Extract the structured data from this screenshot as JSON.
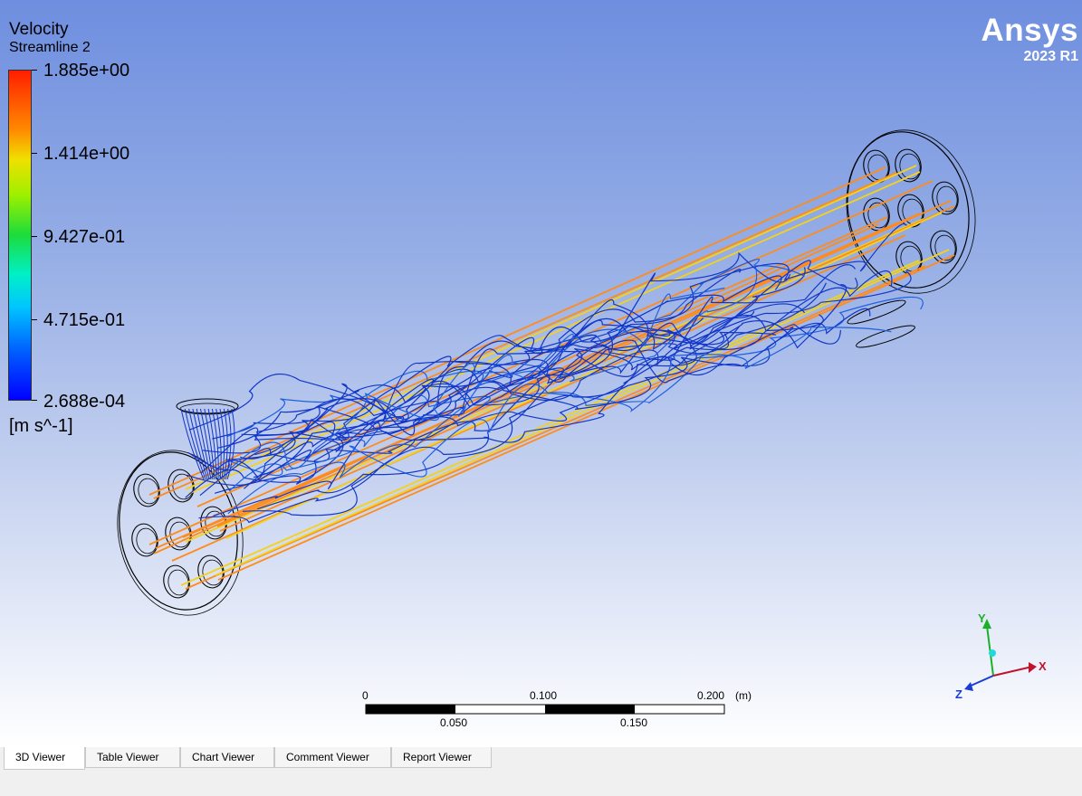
{
  "legend": {
    "title": "Velocity",
    "subtitle": "Streamline 2",
    "levels": [
      "1.885e+00",
      "1.414e+00",
      "9.427e-01",
      "4.715e-01",
      "2.688e-04"
    ],
    "units": "[m s^-1]"
  },
  "branding": {
    "name": "Ansys",
    "version": "2023 R1"
  },
  "scale_bar": {
    "top_labels": [
      "0",
      "0.100",
      "0.200"
    ],
    "bottom_labels": [
      "0.050",
      "0.150"
    ],
    "unit": "(m)"
  },
  "triad": {
    "x": "X",
    "y": "Y",
    "z": "Z"
  },
  "tabs": [
    {
      "label": "3D Viewer",
      "active": true
    },
    {
      "label": "Table Viewer",
      "active": false
    },
    {
      "label": "Chart Viewer",
      "active": false
    },
    {
      "label": "Comment Viewer",
      "active": false
    },
    {
      "label": "Report Viewer",
      "active": false
    }
  ],
  "colors": {
    "stream_fast": "#ff8c1a",
    "stream_mid": "#f4d21a",
    "stream_slow": "#1236c8",
    "triad_x": "#c0142c",
    "triad_y": "#1ab02a",
    "triad_z": "#1a3cd6"
  }
}
